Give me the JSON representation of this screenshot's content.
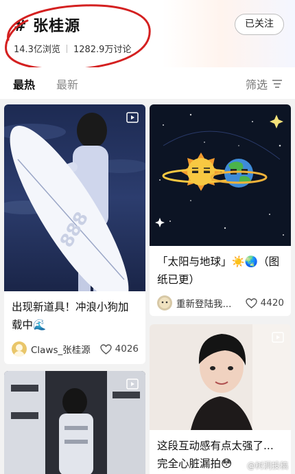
{
  "header": {
    "title": "# 张桂源",
    "views": "14.3亿浏览",
    "discussions": "1282.9万讨论",
    "follow_label": "已关注"
  },
  "tabs": {
    "hot": "最热",
    "latest": "最新",
    "filter": "筛选"
  },
  "posts": [
    {
      "title": "出现新道具！冲浪小狗加载中🌊",
      "author": "Claws_张桂源",
      "likes": "4026",
      "icon": "play-icon"
    },
    {
      "title": "「太阳与地球」☀️🌏（图纸已更）",
      "author": "重新登陆我...",
      "likes": "4420"
    },
    {
      "title": "",
      "author": "",
      "likes": "",
      "icon": "play-icon"
    },
    {
      "title": "这段互动感有点太强了...完全心脏漏拍😳",
      "author": "",
      "likes": "",
      "icon": "play-icon"
    }
  ],
  "watermark": "@树洞投稿",
  "colors": {
    "annotation_ring": "#d42020",
    "page_bg": "#f2f2f2",
    "accent_text": "#111111"
  }
}
